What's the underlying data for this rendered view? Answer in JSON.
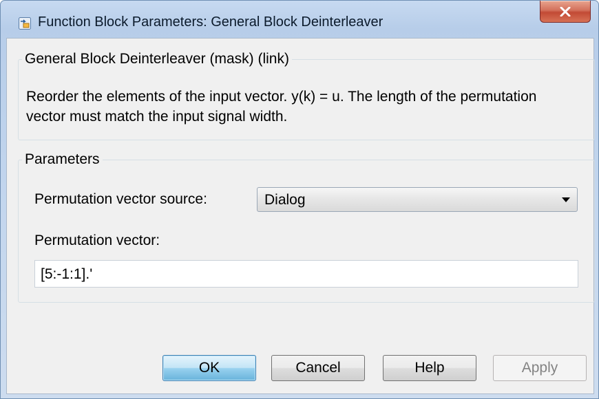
{
  "window": {
    "title": "Function Block Parameters: General Block Deinterleaver",
    "icons": {
      "app": "simulink-block-icon",
      "close": "close-x-icon"
    }
  },
  "mask_group": {
    "legend": "General Block Deinterleaver (mask) (link)",
    "description": "Reorder the elements of the input vector. y(k) = u.  The length of the permutation vector must match the input signal width."
  },
  "parameters_group": {
    "legend": "Parameters",
    "source_label": "Permutation vector source:",
    "source_value": "Dialog",
    "vector_label": "Permutation vector:",
    "vector_value": "[5:-1:1].'"
  },
  "buttons": {
    "ok": "OK",
    "cancel": "Cancel",
    "help": "Help",
    "apply": "Apply"
  },
  "colors": {
    "ok_accent": "#68b3db",
    "close_red": "#c24a35",
    "disabled_text": "#838383"
  }
}
